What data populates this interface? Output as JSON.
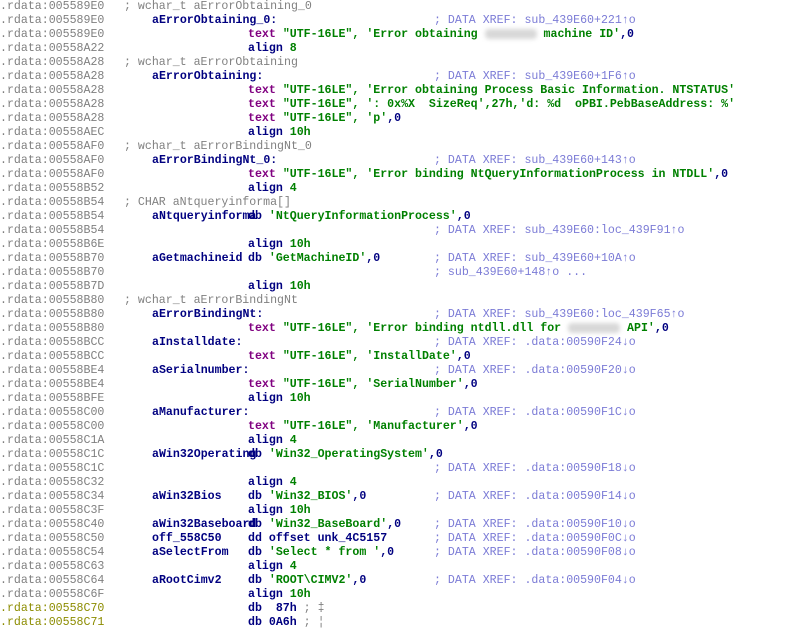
{
  "view": "IDA disassembly listing (.rdata segment)",
  "colors": {
    "address": "#7f7f7f",
    "address_unexplored": "#8c8c00",
    "label": "#000080",
    "directive_text": "#800080",
    "string": "#008000",
    "comment_xref": "#7b7bd6",
    "comment": "#808080"
  },
  "lines": [
    {
      "addr": ".rdata:005589E0",
      "comment": "; wchar_t aErrorObtaining_0"
    },
    {
      "addr": ".rdata:005589E0",
      "label": "aErrorObtaining_0:",
      "xref": "; DATA XREF: sub_439E60+221↑o"
    },
    {
      "addr": ".rdata:005589E0",
      "kw": "text",
      "arg": "\"UTF-16LE\", ",
      "str": "'Error obtaining ",
      "redacted": true,
      "str2": " machine ID'",
      "tail": ",0"
    },
    {
      "addr": ".rdata:00558A22",
      "kw2": "align",
      "num": "8"
    },
    {
      "addr": ".rdata:00558A28",
      "comment": "; wchar_t aErrorObtaining"
    },
    {
      "addr": ".rdata:00558A28",
      "label": "aErrorObtaining:",
      "xref": "; DATA XREF: sub_439E60+1F6↑o"
    },
    {
      "addr": ".rdata:00558A28",
      "kw": "text",
      "arg": "\"UTF-16LE\", ",
      "str": "'Error obtaining Process Basic Information. NTSTATUS'"
    },
    {
      "addr": ".rdata:00558A28",
      "kw": "text",
      "arg": "\"UTF-16LE\", ",
      "str": "': 0x%X  SizeReq',27h,'d: %d  oPBI.PebBaseAddress: %'"
    },
    {
      "addr": ".rdata:00558A28",
      "kw": "text",
      "arg": "\"UTF-16LE\", ",
      "str": "'p'",
      "tail": ",0"
    },
    {
      "addr": ".rdata:00558AEC",
      "kw2": "align",
      "num": "10h"
    },
    {
      "addr": ".rdata:00558AF0",
      "comment": "; wchar_t aErrorBindingNt_0"
    },
    {
      "addr": ".rdata:00558AF0",
      "label": "aErrorBindingNt_0:",
      "xref": "; DATA XREF: sub_439E60+143↑o"
    },
    {
      "addr": ".rdata:00558AF0",
      "kw": "text",
      "arg": "\"UTF-16LE\", ",
      "str": "'Error binding NtQueryInformationProcess in NTDLL'",
      "tail": ",0"
    },
    {
      "addr": ".rdata:00558B52",
      "kw2": "align",
      "num": "4"
    },
    {
      "addr": ".rdata:00558B54",
      "comment": "; CHAR aNtqueryinforma[]"
    },
    {
      "addr": ".rdata:00558B54",
      "label": "aNtqueryinforma",
      "db": "db ",
      "str": "'NtQueryInformationProcess'",
      "tail": ",0",
      "inline_label": true
    },
    {
      "addr": ".rdata:00558B54",
      "xref": "; DATA XREF: sub_439E60:loc_439F91↑o"
    },
    {
      "addr": ".rdata:00558B6E",
      "kw2": "align",
      "num": "10h"
    },
    {
      "addr": ".rdata:00558B70",
      "label": "aGetmachineid",
      "db": "db ",
      "str": "'GetMachineID'",
      "tail": ",0",
      "xref": "; DATA XREF: sub_439E60+10A↑o"
    },
    {
      "addr": ".rdata:00558B70",
      "xref": "; sub_439E60+148↑o ..."
    },
    {
      "addr": ".rdata:00558B7D",
      "kw2": "align",
      "num": "10h"
    },
    {
      "addr": ".rdata:00558B80",
      "comment": "; wchar_t aErrorBindingNt"
    },
    {
      "addr": ".rdata:00558B80",
      "label": "aErrorBindingNt:",
      "xref": "; DATA XREF: sub_439E60:loc_439F65↑o"
    },
    {
      "addr": ".rdata:00558B80",
      "kw": "text",
      "arg": "\"UTF-16LE\", ",
      "str": "'Error binding ntdll.dll for ",
      "redacted": true,
      "str2": " API'",
      "tail": ",0"
    },
    {
      "addr": ".rdata:00558BCC",
      "label": "aInstalldate:",
      "xref": "; DATA XREF: .data:00590F24↓o"
    },
    {
      "addr": ".rdata:00558BCC",
      "kw": "text",
      "arg": "\"UTF-16LE\", ",
      "str": "'InstallDate'",
      "tail": ",0"
    },
    {
      "addr": ".rdata:00558BE4",
      "label": "aSerialnumber:",
      "xref": "; DATA XREF: .data:00590F20↓o"
    },
    {
      "addr": ".rdata:00558BE4",
      "kw": "text",
      "arg": "\"UTF-16LE\", ",
      "str": "'SerialNumber'",
      "tail": ",0"
    },
    {
      "addr": ".rdata:00558BFE",
      "kw2": "align",
      "num": "10h"
    },
    {
      "addr": ".rdata:00558C00",
      "label": "aManufacturer:",
      "xref": "; DATA XREF: .data:00590F1C↓o"
    },
    {
      "addr": ".rdata:00558C00",
      "kw": "text",
      "arg": "\"UTF-16LE\", ",
      "str": "'Manufacturer'",
      "tail": ",0"
    },
    {
      "addr": ".rdata:00558C1A",
      "kw2": "align",
      "num": "4"
    },
    {
      "addr": ".rdata:00558C1C",
      "label": "aWin32Operating",
      "db": "db ",
      "str": "'Win32_OperatingSystem'",
      "tail": ",0",
      "inline_label": true
    },
    {
      "addr": ".rdata:00558C1C",
      "xref": "; DATA XREF: .data:00590F18↓o"
    },
    {
      "addr": ".rdata:00558C32",
      "kw2": "align",
      "num": "4"
    },
    {
      "addr": ".rdata:00558C34",
      "label": "aWin32Bios",
      "db": "db ",
      "str": "'Win32_BIOS'",
      "tail": ",0",
      "xref": "; DATA XREF: .data:00590F14↓o"
    },
    {
      "addr": ".rdata:00558C3F",
      "kw2": "align",
      "num": "10h"
    },
    {
      "addr": ".rdata:00558C40",
      "label": "aWin32Baseboard",
      "db": "db ",
      "str": "'Win32_BaseBoard'",
      "tail": ",0",
      "xref": "; DATA XREF: .data:00590F10↓o",
      "inline_label": true
    },
    {
      "addr": ".rdata:00558C50",
      "label": "off_558C50",
      "db": "dd offset unk_4C5157",
      "xref": "; DATA XREF: .data:00590F0C↓o"
    },
    {
      "addr": ".rdata:00558C54",
      "label": "aSelectFrom",
      "db": "db ",
      "str": "'Select * from '",
      "tail": ",0",
      "xref": "; DATA XREF: .data:00590F08↓o"
    },
    {
      "addr": ".rdata:00558C63",
      "kw2": "align",
      "num": "4"
    },
    {
      "addr": ".rdata:00558C64",
      "label": "aRootCimv2",
      "db": "db ",
      "str": "'ROOT\\CIMV2'",
      "tail": ",0",
      "xref": "; DATA XREF: .data:00590F04↓o"
    },
    {
      "addr": ".rdata:00558C6F",
      "kw2": "align",
      "num": "10h"
    },
    {
      "addr": ".rdata:00558C70",
      "unexplored": true,
      "db": "db  87h ",
      "cmt_after": "; ‡"
    },
    {
      "addr": ".rdata:00558C71",
      "unexplored": true,
      "db": "db 0A6h ",
      "cmt_after": "; ¦"
    }
  ]
}
